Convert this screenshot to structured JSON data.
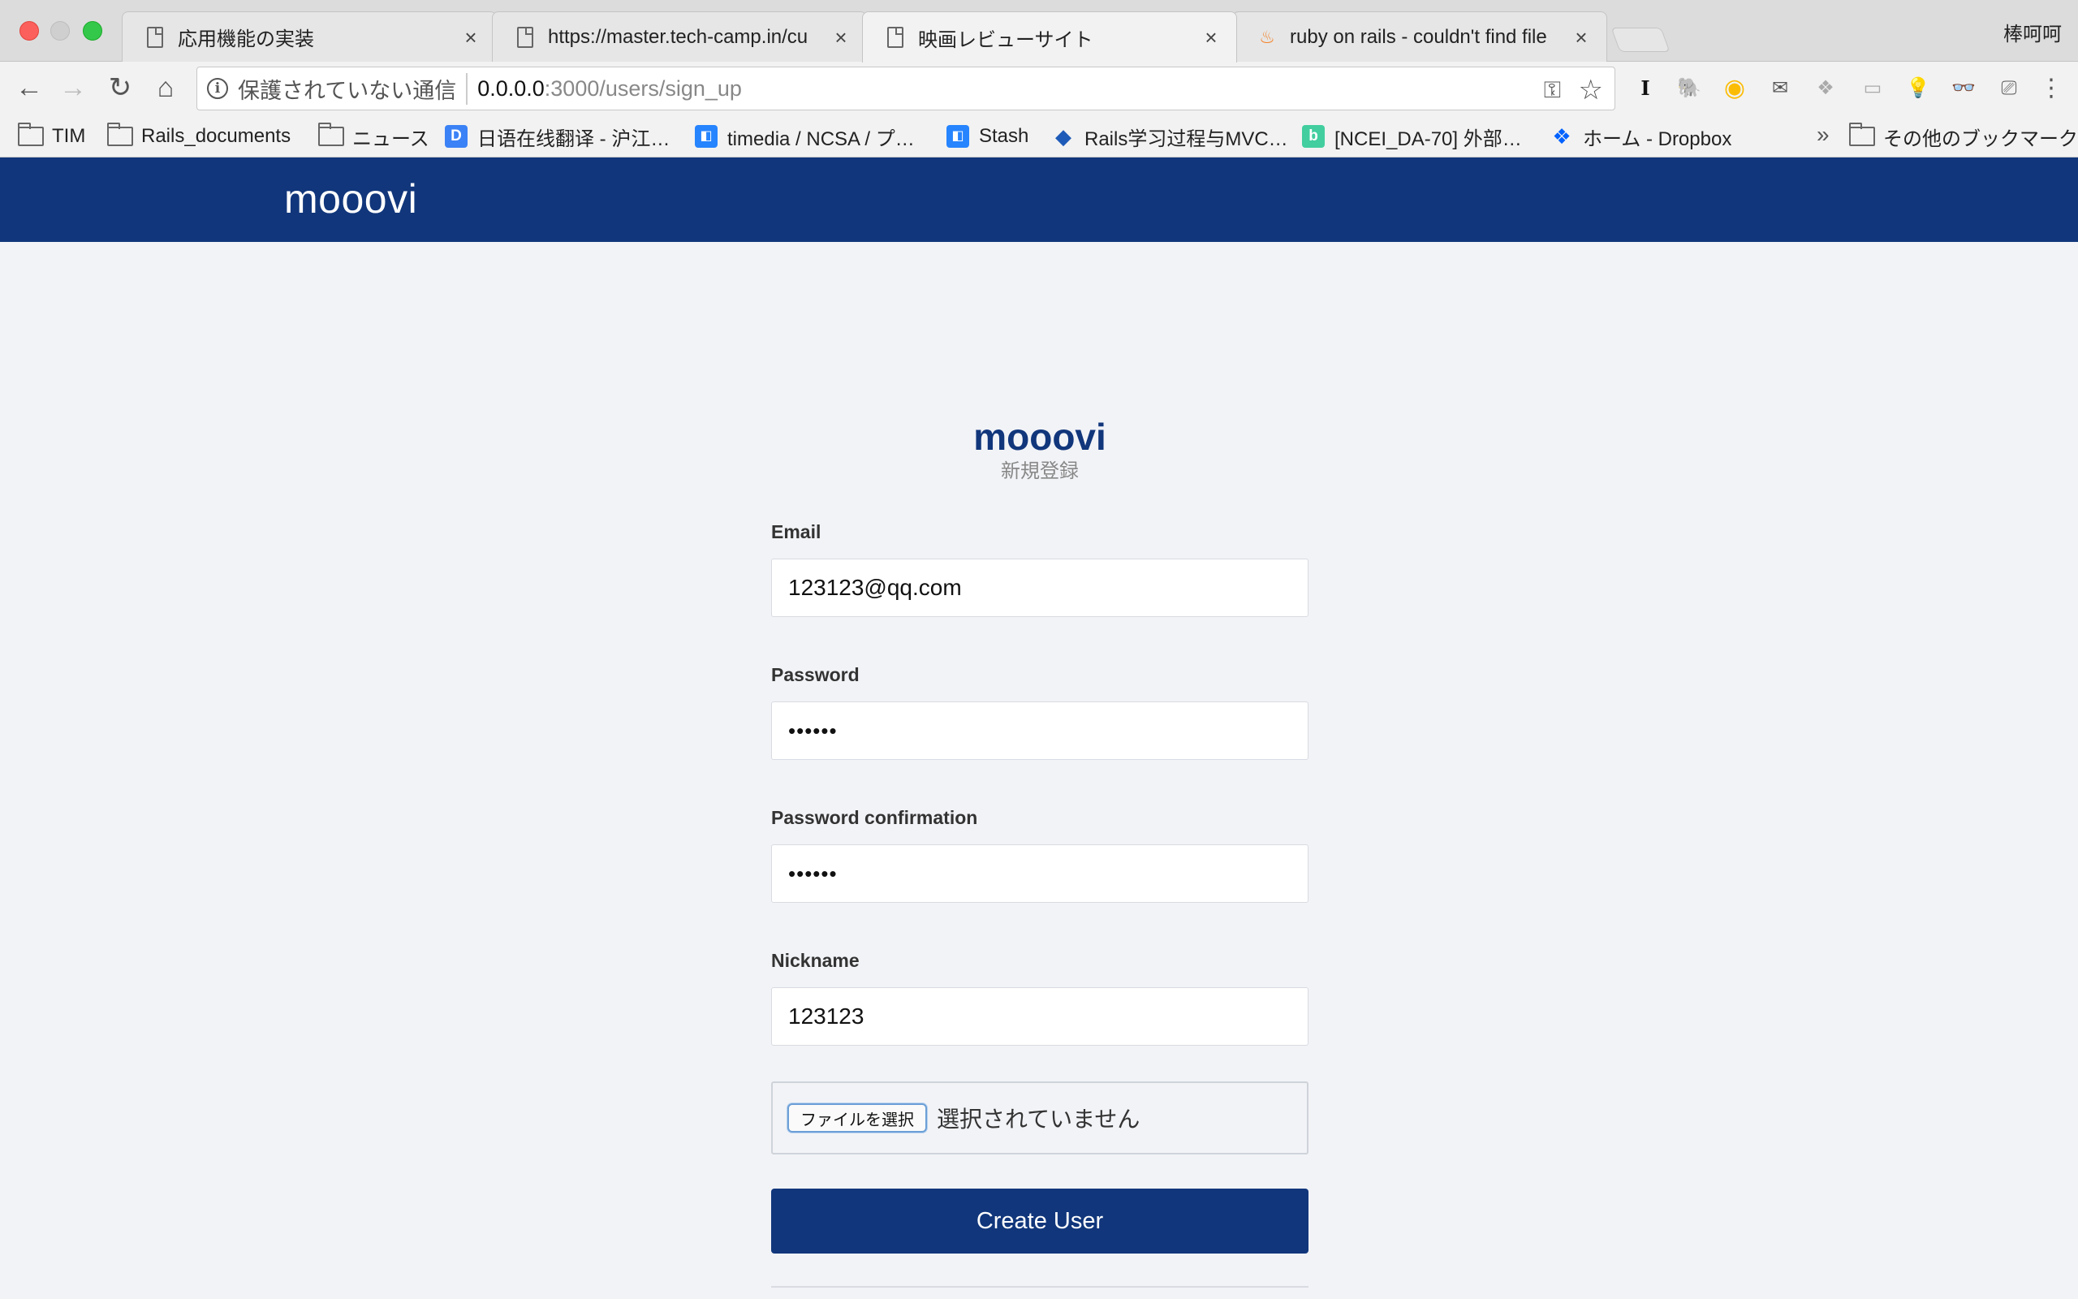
{
  "browser": {
    "profile_name": "棒呵呵",
    "tabs": [
      {
        "label": "応用機能の実装",
        "icon": "document-icon"
      },
      {
        "label": "https://master.tech-camp.in/cu",
        "icon": "document-icon"
      },
      {
        "label": "映画レビューサイト",
        "icon": "document-icon",
        "active": true
      },
      {
        "label": "ruby on rails - couldn't find file",
        "icon": "stackoverflow-icon"
      }
    ],
    "omnibox": {
      "security_text": "保護されていない通信",
      "url_host": "0.0.0.0",
      "url_path": ":3000/users/sign_up"
    },
    "bookmarks": [
      {
        "label": "TIM",
        "icon": "folder-icon"
      },
      {
        "label": "Rails_documents",
        "icon": "folder-icon"
      },
      {
        "label": "ニュース",
        "icon": "folder-icon"
      },
      {
        "label": "日语在线翻译 - 沪江…",
        "icon": "hujiang-icon",
        "color": "#3b82f6",
        "glyph": "D"
      },
      {
        "label": "timedia / NCSA / プ…",
        "icon": "bitbucket-icon",
        "color": "#2684ff",
        "glyph": "⛉"
      },
      {
        "label": "Stash",
        "icon": "bitbucket-icon",
        "color": "#2684ff",
        "glyph": "⛉"
      },
      {
        "label": "Rails学习过程与MVC…",
        "icon": "layers-icon",
        "color": "#1e5bb8",
        "glyph": "◆"
      },
      {
        "label": "[NCEI_DA-70] 外部…",
        "icon": "backlog-icon",
        "color": "#42ce9f",
        "glyph": "b"
      },
      {
        "label": "ホーム - Dropbox",
        "icon": "dropbox-icon",
        "color": "#0061fe",
        "glyph": "❖"
      }
    ],
    "other_bookmarks": "その他のブックマーク"
  },
  "site": {
    "logo": "mooovi"
  },
  "form": {
    "brand": "mooovi",
    "subtitle": "新規登録",
    "email_label": "Email",
    "email_value": "123123@qq.com",
    "password_label": "Password",
    "password_value": "••••••",
    "password_confirmation_label": "Password confirmation",
    "password_confirmation_value": "••••••",
    "nickname_label": "Nickname",
    "nickname_value": "123123",
    "file_button": "ファイルを選択",
    "file_status": "選択されていません",
    "submit_label": "Create User"
  },
  "colors": {
    "brand": "#11367b",
    "page_background": "#f2f3f7"
  }
}
